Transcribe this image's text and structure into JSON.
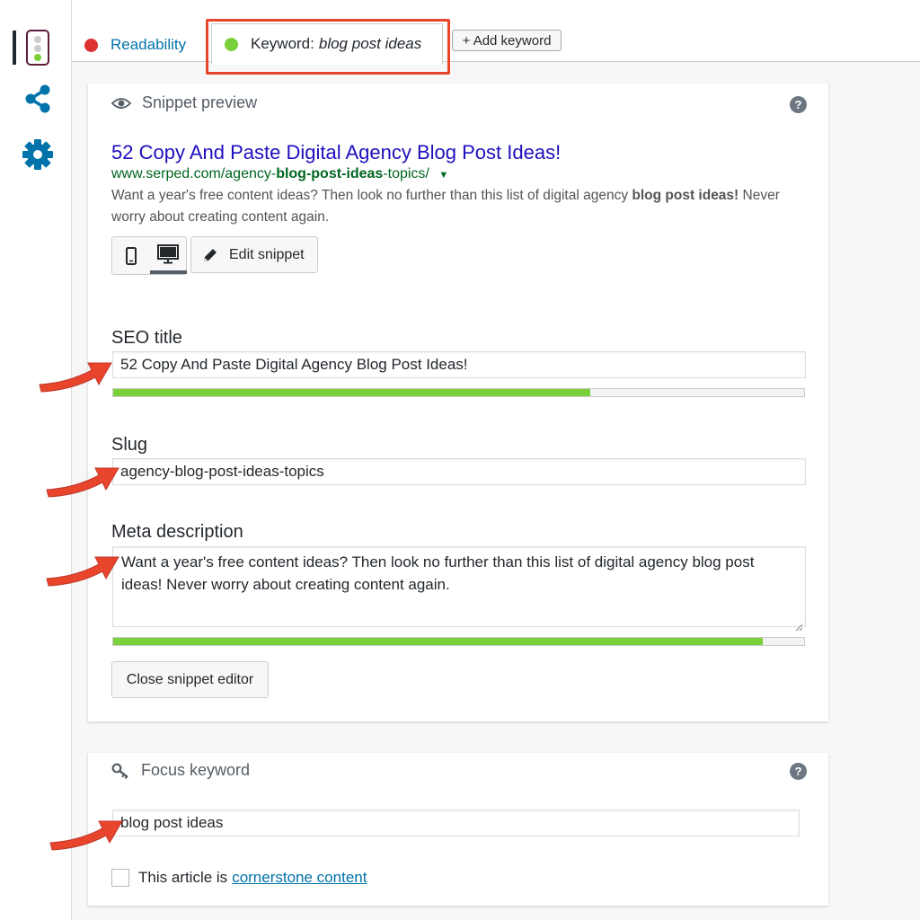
{
  "tabs": {
    "readability_label": "Readability",
    "keyword_prefix": "Keyword:",
    "keyword_value": "blog post ideas",
    "add_keyword_label": "+ Add keyword"
  },
  "colors": {
    "readability_status": "#dc3232",
    "keyword_status": "#7ad03a",
    "highlight": "#e8452c",
    "link": "#0073aa",
    "progress_good": "#7ad03a"
  },
  "sidebar": {
    "icons": [
      "traffic-light-icon",
      "share-icon",
      "gear-icon"
    ]
  },
  "snippet_preview": {
    "heading": "Snippet preview",
    "title": "52 Copy And Paste Digital Agency Blog Post Ideas!",
    "url_prefix": "www.serped.com/agency-",
    "url_bold": "blog-post-ideas",
    "url_suffix": "-topics/",
    "description_before": "Want a year's free content ideas? Then look no further than this list of digital agency ",
    "description_bold": "blog post ideas!",
    "description_after": " Never worry about creating content again.",
    "edit_snippet_label": "Edit snippet"
  },
  "editor": {
    "seo_title_label": "SEO title",
    "seo_title_value": "52 Copy And Paste Digital Agency Blog Post Ideas!",
    "seo_title_progress": 0.69,
    "slug_label": "Slug",
    "slug_value": "agency-blog-post-ideas-topics",
    "meta_label": "Meta description",
    "meta_value": "Want a year's free content ideas? Then look no further than this list of digital agency blog post ideas! Never worry about creating content again.",
    "meta_progress": 0.94,
    "close_label": "Close snippet editor"
  },
  "focus_keyword": {
    "heading": "Focus keyword",
    "value": "blog post ideas",
    "cornerstone_prefix": "This article is",
    "cornerstone_link": "cornerstone content",
    "cornerstone_checked": false
  }
}
